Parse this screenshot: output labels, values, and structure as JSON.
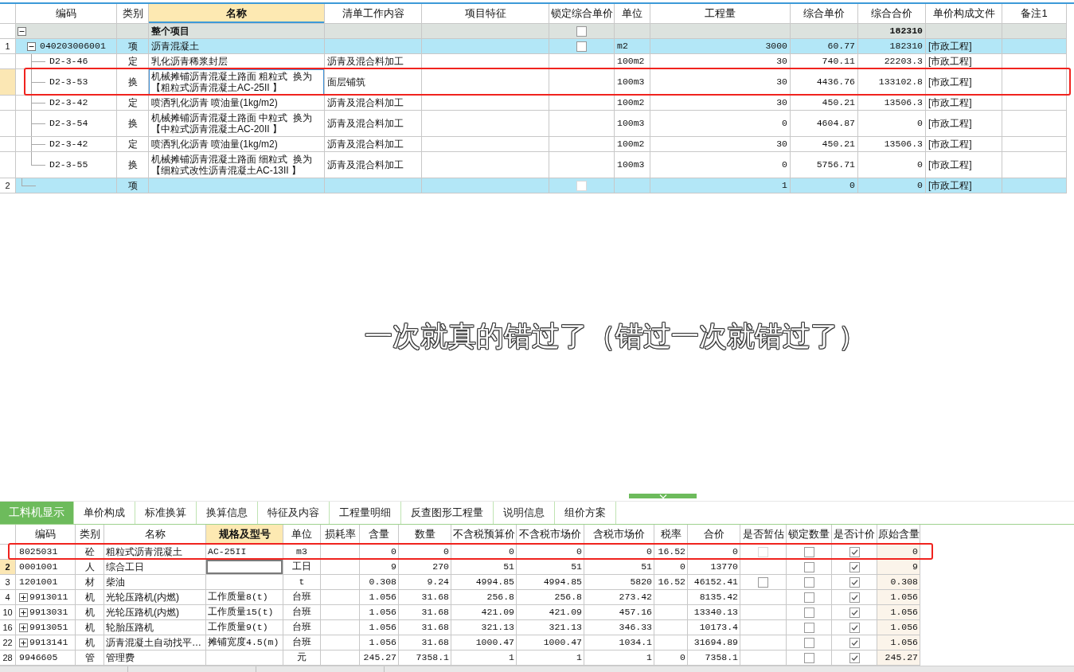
{
  "bill_table": {
    "columns": [
      {
        "label": "编码",
        "selected": false
      },
      {
        "label": "类别",
        "selected": false
      },
      {
        "label": "名称",
        "selected": true
      },
      {
        "label": "清单工作内容",
        "selected": false
      },
      {
        "label": "项目特征",
        "selected": false
      },
      {
        "label": "锁定综合单价",
        "selected": false
      },
      {
        "label": "单位",
        "selected": false
      },
      {
        "label": "工程量",
        "selected": false
      },
      {
        "label": "综合单价",
        "selected": false
      },
      {
        "label": "综合合价",
        "selected": false
      },
      {
        "label": "单价构成文件",
        "selected": false
      },
      {
        "label": "备注1",
        "selected": false
      }
    ],
    "root": {
      "kind": "project",
      "selected": false,
      "highlighted": false,
      "expanded": true,
      "name": "整个项目",
      "lock": {
        "checked": false,
        "disabled": false
      },
      "total_price": "182310",
      "children": [
        {
          "kind": "bill_item",
          "selected": false,
          "highlighted": false,
          "expanded": true,
          "row_number": "1",
          "code": "040203006001",
          "type": "项",
          "name": "沥青混凝土",
          "lock": {
            "checked": false,
            "disabled": false
          },
          "unit": "m2",
          "quantity": "3000",
          "unit_price": "60.77",
          "total_price": "182310",
          "price_file": "[市政工程]",
          "children": [
            {
              "kind": "quota",
              "selected": false,
              "highlighted": false,
              "code": "D2-3-46",
              "type": "定",
              "name": "乳化沥青稀浆封层",
              "work_content": "沥青及混合料加工",
              "unit": "100m2",
              "quantity": "30",
              "unit_price": "740.11",
              "total_price": "22203.3",
              "price_file": "[市政工程]"
            },
            {
              "kind": "quota",
              "selected": true,
              "highlighted": true,
              "code": "D2-3-53",
              "type": "换",
              "name": "机械摊铺沥青混凝土路面 粗粒式  换为【粗粒式沥青混凝土AC-25II 】",
              "work_content": "面层铺筑",
              "unit": "100m3",
              "quantity": "30",
              "unit_price": "4436.76",
              "total_price": "133102.8",
              "price_file": "[市政工程]"
            },
            {
              "kind": "quota",
              "selected": false,
              "highlighted": false,
              "code": "D2-3-42",
              "type": "定",
              "name": "喷洒乳化沥青 喷油量(1kg/m2)",
              "work_content": "沥青及混合料加工",
              "unit": "100m2",
              "quantity": "30",
              "unit_price": "450.21",
              "total_price": "13506.3",
              "price_file": "[市政工程]"
            },
            {
              "kind": "quota",
              "selected": false,
              "highlighted": false,
              "code": "D2-3-54",
              "type": "换",
              "name": "机械摊铺沥青混凝土路面 中粒式  换为【中粒式沥青混凝土AC-20II 】",
              "work_content": "沥青及混合料加工",
              "unit": "100m3",
              "quantity": "0",
              "unit_price": "4604.87",
              "total_price": "0",
              "price_file": "[市政工程]"
            },
            {
              "kind": "quota",
              "selected": false,
              "highlighted": false,
              "code": "D2-3-42",
              "type": "定",
              "name": "喷洒乳化沥青 喷油量(1kg/m2)",
              "work_content": "沥青及混合料加工",
              "unit": "100m2",
              "quantity": "30",
              "unit_price": "450.21",
              "total_price": "13506.3",
              "price_file": "[市政工程]"
            },
            {
              "kind": "quota",
              "selected": false,
              "highlighted": false,
              "code": "D2-3-55",
              "type": "换",
              "name": "机械摊铺沥青混凝土路面 细粒式  换为【细粒式改性沥青混凝土AC-13II 】",
              "work_content": "沥青及混合料加工",
              "unit": "100m3",
              "quantity": "0",
              "unit_price": "5756.71",
              "total_price": "0",
              "price_file": "[市政工程]"
            }
          ]
        },
        {
          "kind": "bill_item",
          "selected": false,
          "highlighted": false,
          "row_number": "2",
          "type": "项",
          "lock": {
            "checked": false,
            "disabled": true
          },
          "quantity": "1",
          "unit_price": "0",
          "total_price": "0",
          "price_file": "[市政工程]"
        }
      ]
    }
  },
  "subtitle": "一次就真的错过了（错过一次就错过了）",
  "detail_panel": {
    "tabs": [
      {
        "label": "工料机显示",
        "selected": true
      },
      {
        "label": "单价构成",
        "selected": false
      },
      {
        "label": "标准换算",
        "selected": false
      },
      {
        "label": "换算信息",
        "selected": false
      },
      {
        "label": "特征及内容",
        "selected": false
      },
      {
        "label": "工程量明细",
        "selected": false
      },
      {
        "label": "反查图形工程量",
        "selected": false
      },
      {
        "label": "说明信息",
        "selected": false
      },
      {
        "label": "组价方案",
        "selected": false
      }
    ],
    "columns": [
      {
        "label": "编码",
        "selected": false
      },
      {
        "label": "类别",
        "selected": false
      },
      {
        "label": "名称",
        "selected": false
      },
      {
        "label": "规格及型号",
        "selected": true
      },
      {
        "label": "单位",
        "selected": false
      },
      {
        "label": "损耗率",
        "selected": false
      },
      {
        "label": "含量",
        "selected": false
      },
      {
        "label": "数量",
        "selected": false
      },
      {
        "label": "不含税预算价",
        "selected": false
      },
      {
        "label": "不含税市场价",
        "selected": false
      },
      {
        "label": "含税市场价",
        "selected": false
      },
      {
        "label": "税率",
        "selected": false
      },
      {
        "label": "合价",
        "selected": false
      },
      {
        "label": "是否暂估",
        "selected": false
      },
      {
        "label": "锁定数量",
        "selected": false
      },
      {
        "label": "是否计价",
        "selected": false
      },
      {
        "label": "原始含量",
        "selected": false
      }
    ],
    "rows": [
      {
        "selected": false,
        "highlighted": true,
        "code": "8025031",
        "type": "砼",
        "name": "粗粒式沥青混凝土",
        "spec": "AC-25II",
        "unit": "m3",
        "content": "0",
        "quantity": "0",
        "budget_price": "0",
        "market_price": "0",
        "market_price_with_tax": "0",
        "tax_rate": "16.52",
        "total": "0",
        "provisional": {
          "checked": false,
          "disabled": true
        },
        "lock_quantity": {
          "checked": false
        },
        "priced": {
          "checked": true
        },
        "original_content": "0"
      },
      {
        "selected": true,
        "highlighted": false,
        "row_number": "2",
        "code": "0001001",
        "type": "人",
        "name": "综合工日",
        "unit": "工日",
        "content": "9",
        "quantity": "270",
        "budget_price": "51",
        "market_price": "51",
        "market_price_with_tax": "51",
        "tax_rate": "0",
        "total": "13770",
        "lock_quantity": {
          "checked": false
        },
        "priced": {
          "checked": true
        },
        "original_content": "9"
      },
      {
        "selected": false,
        "highlighted": false,
        "row_number": "3",
        "code": "1201001",
        "type": "材",
        "name": "柴油",
        "unit": "t",
        "content": "0.308",
        "quantity": "9.24",
        "budget_price": "4994.85",
        "market_price": "4994.85",
        "market_price_with_tax": "5820",
        "tax_rate": "16.52",
        "total": "46152.41",
        "provisional": {
          "checked": false,
          "disabled": false
        },
        "lock_quantity": {
          "checked": false
        },
        "priced": {
          "checked": true
        },
        "original_content": "0.308"
      },
      {
        "selected": false,
        "highlighted": false,
        "row_number": "4",
        "expanded": false,
        "code": "9913011",
        "type": "机",
        "name": "光轮压路机(内燃)",
        "spec": "工作质量8(t)",
        "unit": "台班",
        "content": "1.056",
        "quantity": "31.68",
        "budget_price": "256.8",
        "market_price": "256.8",
        "market_price_with_tax": "273.42",
        "total": "8135.42",
        "lock_quantity": {
          "checked": false
        },
        "priced": {
          "checked": true
        },
        "original_content": "1.056"
      },
      {
        "selected": false,
        "highlighted": false,
        "row_number": "10",
        "expanded": false,
        "code": "9913031",
        "type": "机",
        "name": "光轮压路机(内燃)",
        "spec": "工作质量15(t)",
        "unit": "台班",
        "content": "1.056",
        "quantity": "31.68",
        "budget_price": "421.09",
        "market_price": "421.09",
        "market_price_with_tax": "457.16",
        "total": "13340.13",
        "lock_quantity": {
          "checked": false
        },
        "priced": {
          "checked": true
        },
        "original_content": "1.056"
      },
      {
        "selected": false,
        "highlighted": false,
        "row_number": "16",
        "expanded": false,
        "code": "9913051",
        "type": "机",
        "name": "轮胎压路机",
        "spec": "工作质量9(t)",
        "unit": "台班",
        "content": "1.056",
        "quantity": "31.68",
        "budget_price": "321.13",
        "market_price": "321.13",
        "market_price_with_tax": "346.33",
        "total": "10173.4",
        "lock_quantity": {
          "checked": false
        },
        "priced": {
          "checked": true
        },
        "original_content": "1.056"
      },
      {
        "selected": false,
        "highlighted": false,
        "row_number": "22",
        "expanded": false,
        "code": "9913141",
        "type": "机",
        "name": "沥青混凝土自动找平…",
        "spec": "摊铺宽度4.5(m)",
        "unit": "台班",
        "content": "1.056",
        "quantity": "31.68",
        "budget_price": "1000.47",
        "market_price": "1000.47",
        "market_price_with_tax": "1034.1",
        "total": "31694.89",
        "lock_quantity": {
          "checked": false
        },
        "priced": {
          "checked": true
        },
        "original_content": "1.056"
      },
      {
        "selected": false,
        "highlighted": false,
        "row_number": "28",
        "code": "9946605",
        "type": "管",
        "name": "管理费",
        "unit": "元",
        "content": "245.27",
        "quantity": "7358.1",
        "budget_price": "1",
        "market_price": "1",
        "market_price_with_tax": "1",
        "tax_rate": "0",
        "total": "7358.1",
        "lock_quantity": {
          "checked": false
        },
        "priced": {
          "checked": true
        },
        "original_content": "245.27"
      }
    ]
  }
}
